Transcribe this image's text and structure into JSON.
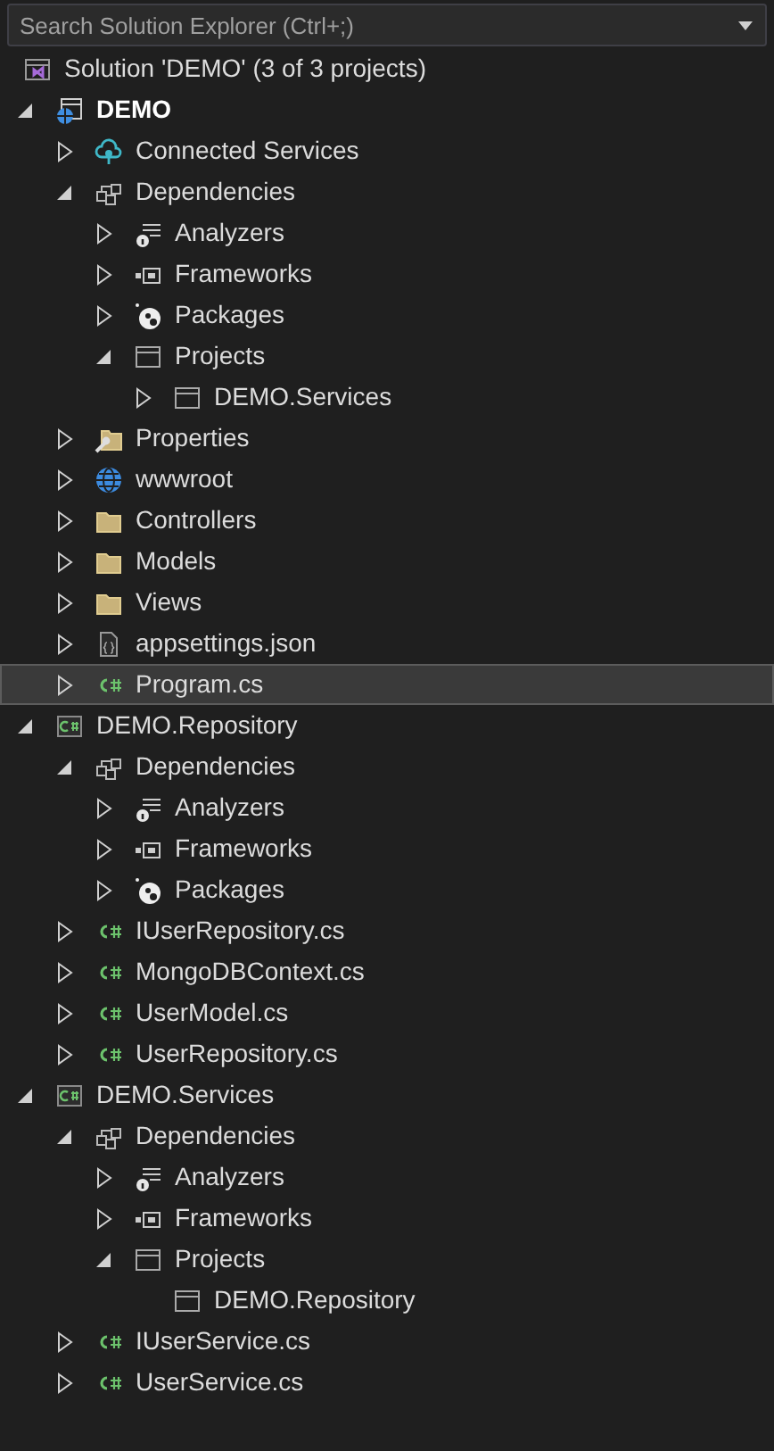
{
  "search": {
    "placeholder": "Search Solution Explorer (Ctrl+;)"
  },
  "tree": [
    {
      "label": "Solution 'DEMO' (3 of 3 projects)",
      "kind": "solution",
      "selected": false,
      "children": [
        {
          "label": "DEMO",
          "kind": "web-project",
          "startup": true,
          "expanded": true,
          "selected": false,
          "children": [
            {
              "label": "Connected Services",
              "kind": "connected",
              "expanded": false,
              "selected": false
            },
            {
              "label": "Dependencies",
              "kind": "dependencies",
              "expanded": true,
              "selected": false,
              "children": [
                {
                  "label": "Analyzers",
                  "kind": "analyzers",
                  "expanded": false,
                  "selected": false
                },
                {
                  "label": "Frameworks",
                  "kind": "frameworks",
                  "expanded": false,
                  "selected": false
                },
                {
                  "label": "Packages",
                  "kind": "packages",
                  "expanded": false,
                  "selected": false
                },
                {
                  "label": "Projects",
                  "kind": "projects",
                  "expanded": true,
                  "selected": false,
                  "children": [
                    {
                      "label": "DEMO.Services",
                      "kind": "project-ref",
                      "expanded": false,
                      "selected": false
                    }
                  ]
                }
              ]
            },
            {
              "label": "Properties",
              "kind": "properties",
              "expanded": false,
              "selected": false
            },
            {
              "label": "wwwroot",
              "kind": "globe",
              "expanded": false,
              "selected": false
            },
            {
              "label": "Controllers",
              "kind": "folder",
              "expanded": false,
              "selected": false
            },
            {
              "label": "Models",
              "kind": "folder",
              "expanded": false,
              "selected": false
            },
            {
              "label": "Views",
              "kind": "folder",
              "expanded": false,
              "selected": false
            },
            {
              "label": "appsettings.json",
              "kind": "json",
              "expanded": false,
              "selected": false
            },
            {
              "label": "Program.cs",
              "kind": "csharp",
              "expanded": false,
              "selected": true
            }
          ]
        },
        {
          "label": "DEMO.Repository",
          "kind": "csharp-project",
          "startup": false,
          "expanded": true,
          "selected": false,
          "children": [
            {
              "label": "Dependencies",
              "kind": "dependencies",
              "expanded": true,
              "selected": false,
              "children": [
                {
                  "label": "Analyzers",
                  "kind": "analyzers",
                  "expanded": false,
                  "selected": false
                },
                {
                  "label": "Frameworks",
                  "kind": "frameworks",
                  "expanded": false,
                  "selected": false
                },
                {
                  "label": "Packages",
                  "kind": "packages",
                  "expanded": false,
                  "selected": false
                }
              ]
            },
            {
              "label": "IUserRepository.cs",
              "kind": "csharp",
              "expanded": false,
              "selected": false
            },
            {
              "label": "MongoDBContext.cs",
              "kind": "csharp",
              "expanded": false,
              "selected": false
            },
            {
              "label": "UserModel.cs",
              "kind": "csharp",
              "expanded": false,
              "selected": false
            },
            {
              "label": "UserRepository.cs",
              "kind": "csharp",
              "expanded": false,
              "selected": false
            }
          ]
        },
        {
          "label": "DEMO.Services",
          "kind": "csharp-project",
          "startup": false,
          "expanded": true,
          "selected": false,
          "children": [
            {
              "label": "Dependencies",
              "kind": "dependencies",
              "expanded": true,
              "selected": false,
              "children": [
                {
                  "label": "Analyzers",
                  "kind": "analyzers",
                  "expanded": false,
                  "selected": false
                },
                {
                  "label": "Frameworks",
                  "kind": "frameworks",
                  "expanded": false,
                  "selected": false
                },
                {
                  "label": "Projects",
                  "kind": "projects",
                  "expanded": true,
                  "selected": false,
                  "children": [
                    {
                      "label": "DEMO.Repository",
                      "kind": "project-ref",
                      "selected": false
                    }
                  ]
                }
              ]
            },
            {
              "label": "IUserService.cs",
              "kind": "csharp",
              "expanded": false,
              "selected": false
            },
            {
              "label": "UserService.cs",
              "kind": "csharp",
              "expanded": false,
              "selected": false
            }
          ]
        }
      ]
    }
  ]
}
